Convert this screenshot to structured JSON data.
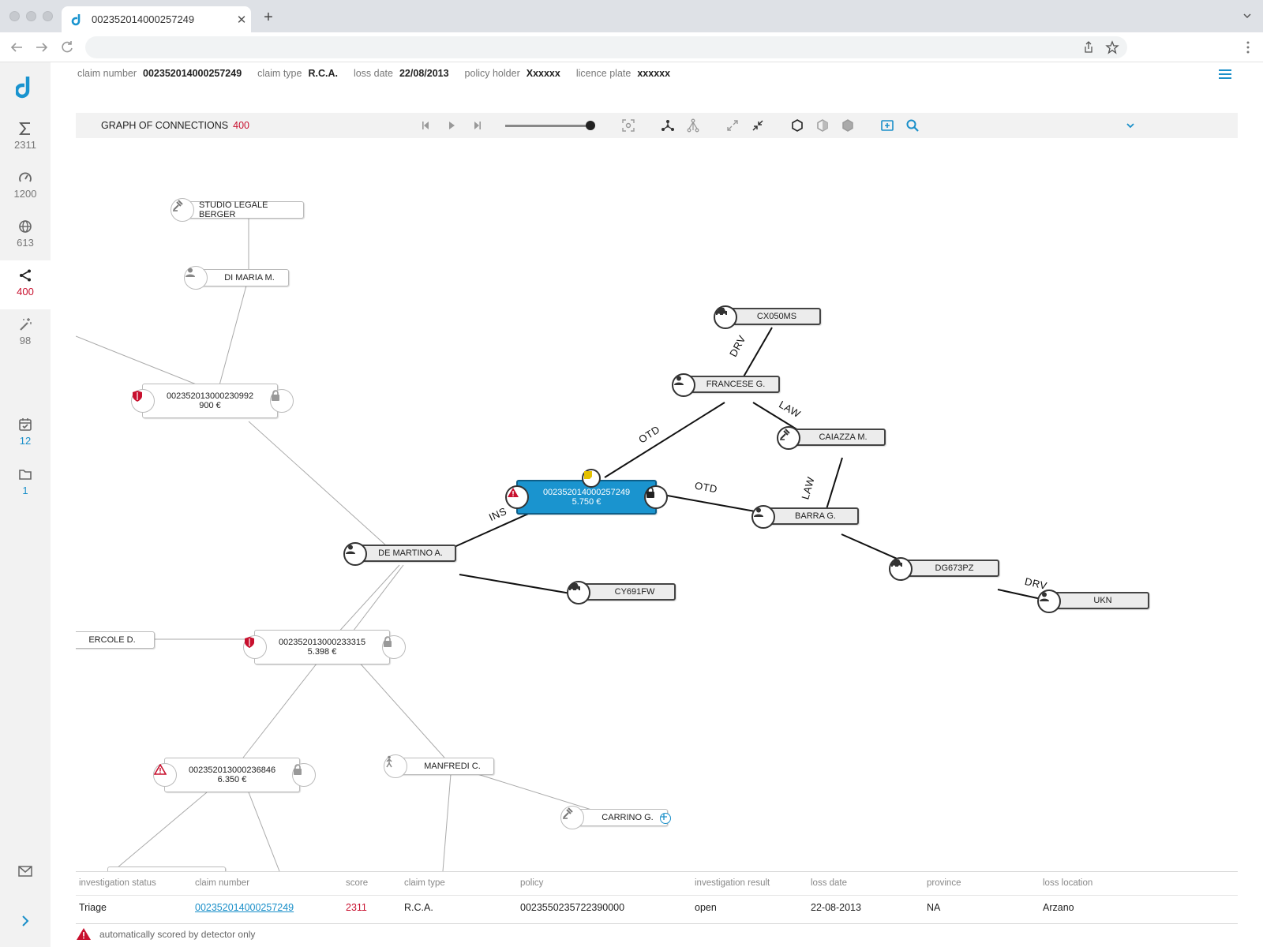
{
  "browser": {
    "tab_title": "002352014000257249",
    "new_tab": "+",
    "close": "✕"
  },
  "sidebar": {
    "items": [
      {
        "icon": "sigma-icon",
        "count": "2311"
      },
      {
        "icon": "speedometer-icon",
        "count": "1200"
      },
      {
        "icon": "globe-icon",
        "count": "613"
      },
      {
        "icon": "share-icon",
        "count": "400"
      },
      {
        "icon": "magic-wand-icon",
        "count": "98"
      },
      {
        "icon": "calendar-check-icon",
        "count": "12"
      },
      {
        "icon": "folder-icon",
        "count": "1"
      }
    ],
    "accent_active": "#c8102e",
    "accent_blue": "#1a8fc9"
  },
  "header": {
    "claim_number_label": "claim number",
    "claim_number": "002352014000257249",
    "claim_type_label": "claim type",
    "claim_type": "R.C.A.",
    "loss_date_label": "loss date",
    "loss_date": "22/08/2013",
    "policy_holder_label": "policy holder",
    "policy_holder": "Xxxxxx",
    "licence_plate_label": "licence plate",
    "licence_plate": "xxxxxx"
  },
  "graph_toolbar": {
    "title": "GRAPH OF CONNECTIONS",
    "count": "400",
    "slider_level": 1.0
  },
  "graph": {
    "nodes": {
      "studio": "STUDIO LEGALE BERGER",
      "dimaria": "DI MARIA M.",
      "claim230992_id": "002352013000230992",
      "claim230992_amt": "900 €",
      "central_id": "002352014000257249",
      "central_amt": "5.750 €",
      "demartino": "DE MARTINO A.",
      "cy691fw": "CY691FW",
      "ercole": "ERCOLE D.",
      "claim233315_id": "002352013000233315",
      "claim233315_amt": "5.398 €",
      "claim236846_id": "002352013000236846",
      "claim236846_amt": "6.350 €",
      "manfredi": "MANFREDI C.",
      "carrino": "CARRINO G.",
      "cx050ms": "CX050MS",
      "francese": "FRANCESE G.",
      "caiazza": "CAIAZZA M.",
      "barra": "BARRA G.",
      "dg673pz": "DG673PZ",
      "ukn": "UKN"
    },
    "edge_labels": {
      "drv1": "DRV",
      "law1": "LAW",
      "otd1": "OTD",
      "law2": "LAW",
      "otd2": "OTD",
      "ins": "INS",
      "drv2": "DRV"
    }
  },
  "table": {
    "headers": {
      "investigation_status": "investigation status",
      "claim_number": "claim number",
      "score": "score",
      "claim_type": "claim type",
      "policy": "policy",
      "investigation_result": "investigation result",
      "loss_date": "loss date",
      "province": "province",
      "loss_location": "loss location"
    },
    "row": {
      "investigation_status": "Triage",
      "claim_number": "002352014000257249",
      "score": "2311",
      "claim_type": "R.C.A.",
      "policy": "0023550235722390000",
      "investigation_result": "open",
      "loss_date": "22-08-2013",
      "province": "NA",
      "loss_location": "Arzano"
    }
  },
  "footnote": "automatically scored by detector only"
}
